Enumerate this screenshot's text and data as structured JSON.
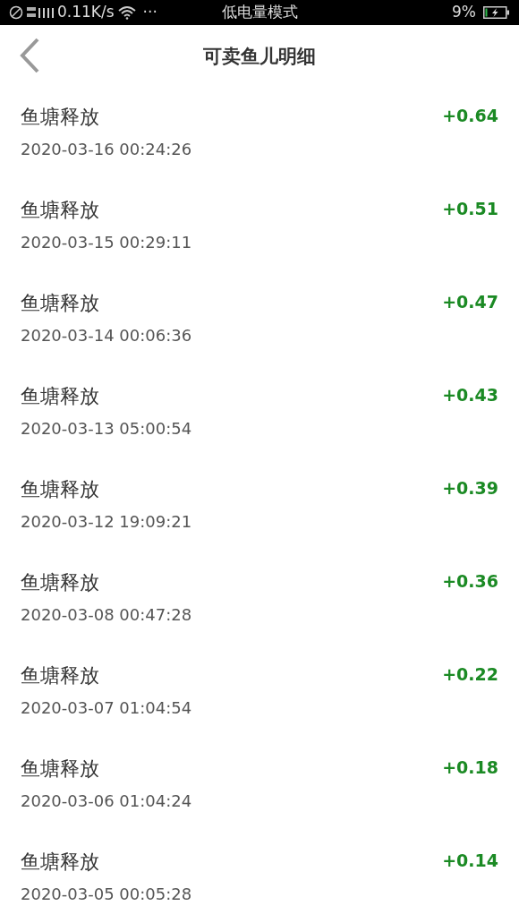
{
  "status_bar": {
    "network_speed": "0.11K/s",
    "dots": "···",
    "mode": "低电量模式",
    "battery_percent": "9%",
    "battery": {
      "level": 0.09,
      "charging": true
    }
  },
  "header": {
    "title": "可卖鱼儿明细"
  },
  "records": [
    {
      "label": "鱼塘释放",
      "time": "2020-03-16 00:24:26",
      "amount": "+0.64"
    },
    {
      "label": "鱼塘释放",
      "time": "2020-03-15 00:29:11",
      "amount": "+0.51"
    },
    {
      "label": "鱼塘释放",
      "time": "2020-03-14 00:06:36",
      "amount": "+0.47"
    },
    {
      "label": "鱼塘释放",
      "time": "2020-03-13 05:00:54",
      "amount": "+0.43"
    },
    {
      "label": "鱼塘释放",
      "time": "2020-03-12 19:09:21",
      "amount": "+0.39"
    },
    {
      "label": "鱼塘释放",
      "time": "2020-03-08 00:47:28",
      "amount": "+0.36"
    },
    {
      "label": "鱼塘释放",
      "time": "2020-03-07 01:04:54",
      "amount": "+0.22"
    },
    {
      "label": "鱼塘释放",
      "time": "2020-03-06 01:04:24",
      "amount": "+0.18"
    },
    {
      "label": "鱼塘释放",
      "time": "2020-03-05 00:05:28",
      "amount": "+0.14"
    }
  ]
}
